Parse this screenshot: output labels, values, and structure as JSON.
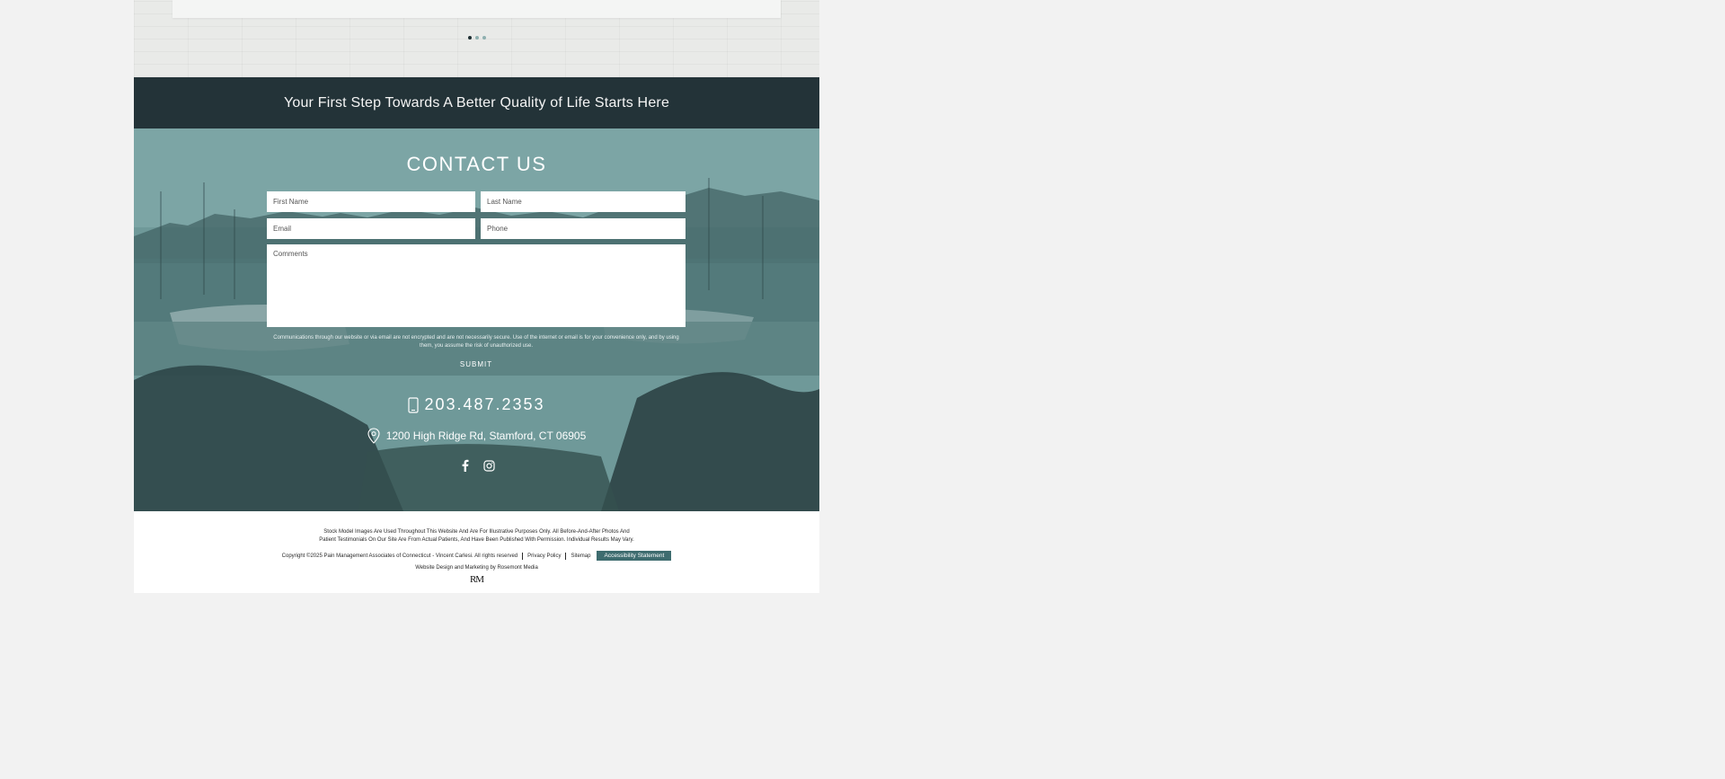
{
  "slider": {
    "dot_count": 3,
    "active_index": 0
  },
  "banner": {
    "text": "Your First Step Towards A Better Quality of Life Starts Here"
  },
  "contact": {
    "title": "CONTACT US",
    "first_name_placeholder": "First Name",
    "last_name_placeholder": "Last Name",
    "email_placeholder": "Email",
    "phone_placeholder": "Phone",
    "comments_placeholder": "Comments",
    "disclaimer": "Communications through our website or via email are not encrypted and are not necessarily secure. Use of the internet or email is for your convenience only, and by using them, you assume the risk of unauthorized use.",
    "submit_label": "SUBMIT",
    "phone": "203.487.2353",
    "address": "1200 High Ridge Rd, Stamford, CT 06905",
    "social_icons": [
      "facebook-icon",
      "instagram-icon"
    ]
  },
  "footer": {
    "note_line1": "Stock Model Images Are Used Throughout This Website And Are For Illustrative Purposes Only. All Before-And-After Photos And",
    "note_line2": "Patient Testimonials On Our Site Are From Actual Patients, And Have Been Published With Permission. Individual Results May Vary.",
    "copyright": "Copyright ©2025  Pain Management Associates of Connecticut - Vincent Carlesi. All rights reserved",
    "privacy_label": "Privacy Policy",
    "sitemap_label": "Sitemap",
    "accessibility_label": "Accessibility Statement",
    "design_credit": "Website Design and Marketing by Rosemont Media",
    "logo_text": "RM"
  },
  "colors": {
    "page_bg": "#f2f2f2",
    "banner_bg": "#233338",
    "accent": "#3e6c6f",
    "contact_overlay": "#5f8a8b"
  }
}
